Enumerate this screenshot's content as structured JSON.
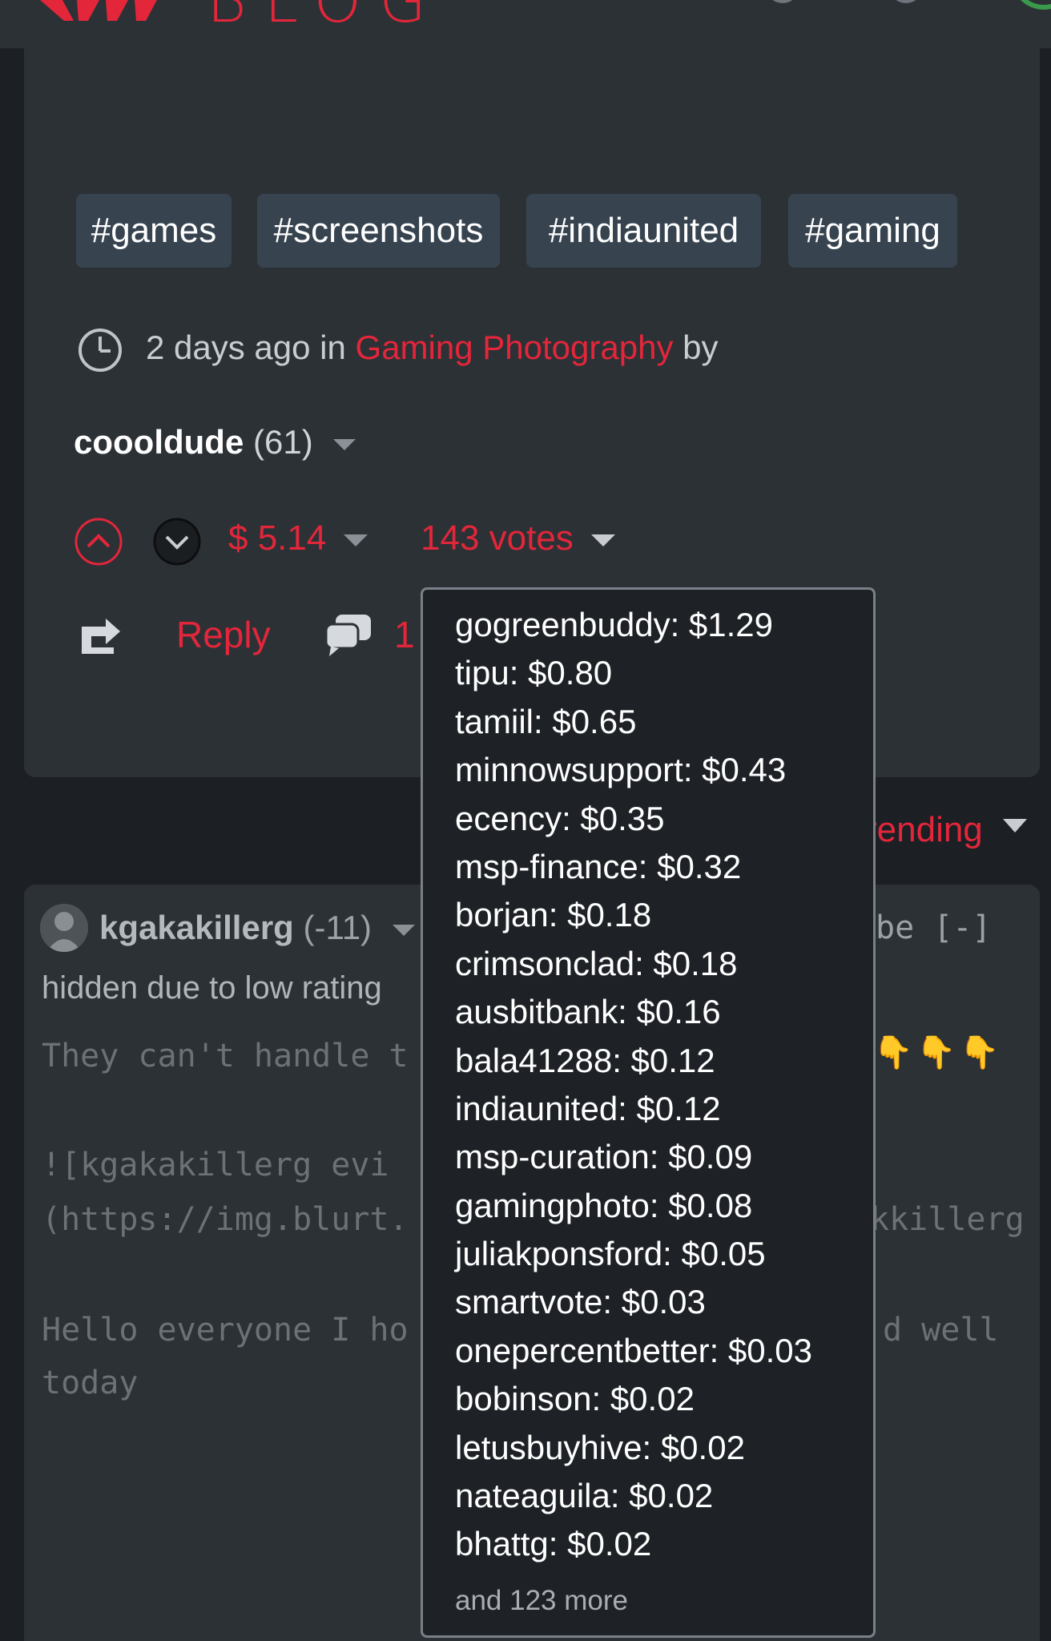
{
  "header": {
    "logo_text": "BLOG"
  },
  "post": {
    "tags": [
      "#games",
      "#screenshots",
      "#indiaunited",
      "#gaming"
    ],
    "meta": {
      "time": "2 days ago in",
      "category": "Gaming Photography",
      "by": "by"
    },
    "author": {
      "name": "coooldude",
      "reputation": "(61)"
    },
    "payout": "$ 5.14",
    "votes": "143 votes",
    "reply_label": "Reply",
    "comments_count": "1"
  },
  "voters_tooltip": {
    "items": [
      "gogreenbuddy: $1.29",
      "tipu: $0.80",
      "tamiil: $0.65",
      "minnowsupport: $0.43",
      "ecency: $0.35",
      "msp-finance: $0.32",
      "borjan: $0.18",
      "crimsonclad: $0.18",
      "ausbitbank: $0.16",
      "bala41288: $0.12",
      "indiaunited: $0.12",
      "msp-curation: $0.09",
      "gamingphoto: $0.08",
      "juliakponsford: $0.05",
      "smartvote: $0.03",
      "onepercentbetter: $0.03",
      "bobinson: $0.02",
      "letusbuyhive: $0.02",
      "nateaguila: $0.02",
      "bhattg: $0.02"
    ],
    "more": "and 123 more"
  },
  "sort": {
    "label": "rending"
  },
  "comment": {
    "author": "kgakakillerg",
    "reputation": "(-11)",
    "right_text": "be  [-]",
    "hidden_note": "hidden due to low rating",
    "lines": [
      "They can't handle t",
      "![kgakakillerg evi",
      "(https://img.blurt.",
      "Hello everyone I ho",
      "today"
    ],
    "line_tail_1": "kkillerg",
    "line_tail_2": "d well"
  }
}
